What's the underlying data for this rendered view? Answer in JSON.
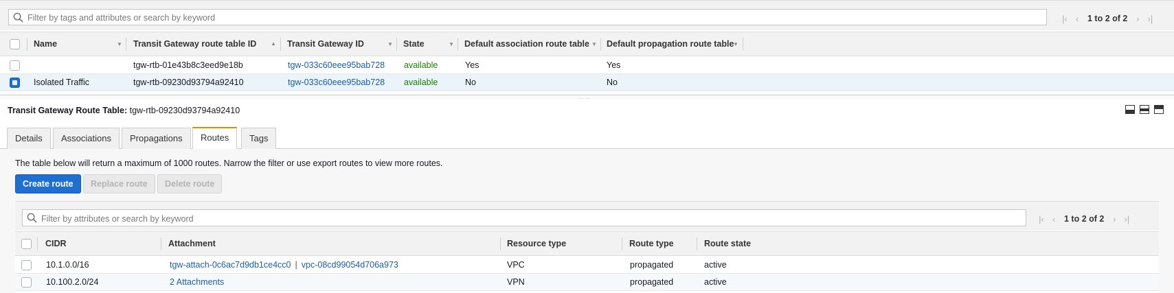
{
  "top": {
    "search_placeholder": "Filter by tags and attributes or search by keyword",
    "pager_text": "1 to 2 of 2"
  },
  "route_tables": {
    "columns": [
      "Name",
      "Transit Gateway route table ID",
      "Transit Gateway ID",
      "State",
      "Default association route table",
      "Default propagation route table"
    ],
    "rows": [
      {
        "selected": false,
        "name": "",
        "rtb_id": "tgw-rtb-01e43b8c3eed9e18b",
        "tgw_id": "tgw-033c60eee95bab728",
        "state": "available",
        "default_assoc": "Yes",
        "default_prop": "Yes"
      },
      {
        "selected": true,
        "name": "Isolated Traffic",
        "rtb_id": "tgw-rtb-09230d93794a92410",
        "tgw_id": "tgw-033c60eee95bab728",
        "state": "available",
        "default_assoc": "No",
        "default_prop": "No"
      }
    ]
  },
  "detail": {
    "title_label": "Transit Gateway Route Table:",
    "title_value": "tgw-rtb-09230d93794a92410",
    "tabs": [
      "Details",
      "Associations",
      "Propagations",
      "Routes",
      "Tags"
    ],
    "active_tab": "Routes",
    "note": "The table below will return a maximum of 1000 routes. Narrow the filter or use export routes to view more routes.",
    "buttons": {
      "create": "Create route",
      "replace": "Replace route",
      "delete": "Delete route"
    }
  },
  "routes": {
    "search_placeholder": "Filter by attributes or search by keyword",
    "pager_text": "1 to 2 of 2",
    "columns": [
      "CIDR",
      "Attachment",
      "Resource type",
      "Route type",
      "Route state"
    ],
    "rows": [
      {
        "cidr": "10.1.0.0/16",
        "attachment": "tgw-attach-0c6ac7d9db1ce4cc0",
        "attachment_sep": "|",
        "attachment_vpc": "vpc-08cd99054d706a973",
        "resource_type": "VPC",
        "route_type": "propagated",
        "route_state": "active"
      },
      {
        "cidr": "10.100.2.0/24",
        "attachment": "2 Attachments",
        "attachment_sep": "",
        "attachment_vpc": "",
        "resource_type": "VPN",
        "route_type": "propagated",
        "route_state": "active"
      }
    ]
  },
  "colors": {
    "primary_button": "#1f6fd0",
    "link": "#1b5fa8",
    "available": "#1d8102",
    "active_tab_accent": "#e58a00",
    "selected_row": "#ebf3fb"
  },
  "icons": [
    "search-icon",
    "first-page-icon",
    "prev-page-icon",
    "next-page-icon",
    "last-page-icon",
    "sort-asc-icon",
    "sort-desc-icon",
    "layout-bottom-icon",
    "layout-split-icon",
    "layout-top-icon"
  ]
}
